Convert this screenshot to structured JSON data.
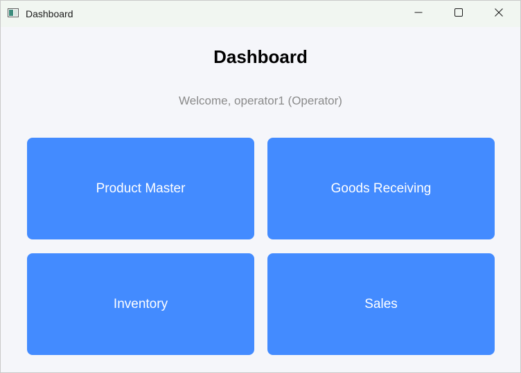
{
  "window": {
    "title": "Dashboard",
    "icon": "app-window-icon",
    "controls": {
      "minimize_icon": "minimize-icon",
      "maximize_icon": "maximize-icon",
      "close_icon": "close-icon"
    }
  },
  "main": {
    "heading": "Dashboard",
    "welcome": "Welcome, operator1 (Operator)",
    "tiles": [
      {
        "label": "Product Master"
      },
      {
        "label": "Goods Receiving"
      },
      {
        "label": "Inventory"
      },
      {
        "label": "Sales"
      }
    ]
  },
  "colors": {
    "tile_background": "#438bff",
    "tile_text": "#ffffff",
    "window_background": "#f5f6fa",
    "titlebar_background": "#f1f6f1",
    "welcome_text": "#8a8a8a"
  }
}
